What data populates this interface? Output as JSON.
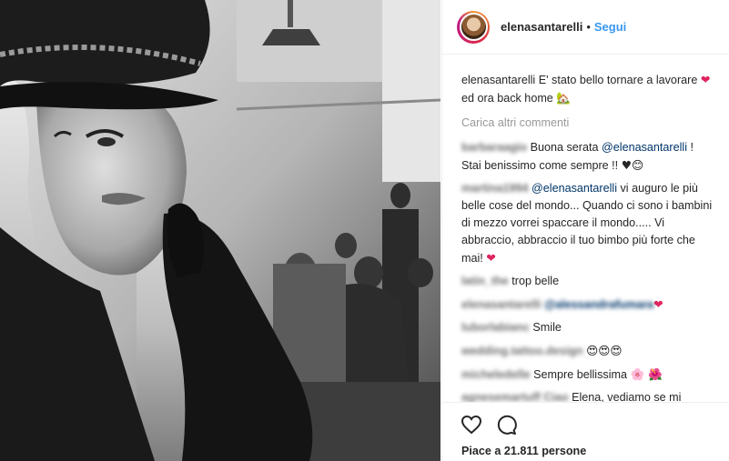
{
  "header": {
    "username": "elenasantarelli",
    "separator": "•",
    "follow_label": "Segui"
  },
  "caption": {
    "username": "elenasantarelli",
    "text_a": "E' stato bello tornare a lavorare ",
    "text_b": "ed ora back home ",
    "heart": "❤",
    "house": "🏡"
  },
  "load_more": "Carica altri commenti",
  "comments": [
    {
      "user": "barbaraagio",
      "parts": [
        "Buona serata ",
        "@elenasantarelli",
        " ! Stai benissimo come sempre !! ",
        "♥😊"
      ]
    },
    {
      "user": "martina1994",
      "parts": [
        "@elenasantarelli",
        " vi auguro le più belle cose del mondo... Quando ci sono i bambini di mezzo vorrei spaccare il mondo..... Vi abbraccio, abbraccio il tuo bimbo più forte che mai! ",
        "❤"
      ]
    },
    {
      "user": "latin_the",
      "parts": [
        "trop belle"
      ]
    },
    {
      "user": "elenasantarelli",
      "parts": [
        "@alessandrafumara",
        "❤"
      ]
    },
    {
      "user": "luborlabianc",
      "parts": [
        "Smile"
      ]
    },
    {
      "user": "wedding.tattoo.design",
      "parts": [
        "😍😍😍"
      ]
    },
    {
      "user": "micheledelle",
      "parts": [
        "Sempre bellissima ",
        "🌸 🌺"
      ]
    },
    {
      "user": "agnesemartuff Ciao",
      "parts": [
        " Elena, vediamo se mi riconosci! Ti seguo, ti mando un"
      ]
    }
  ],
  "likes_text": "Piace a 21.811 persone",
  "icons": [
    "heart-icon",
    "comment-icon"
  ]
}
